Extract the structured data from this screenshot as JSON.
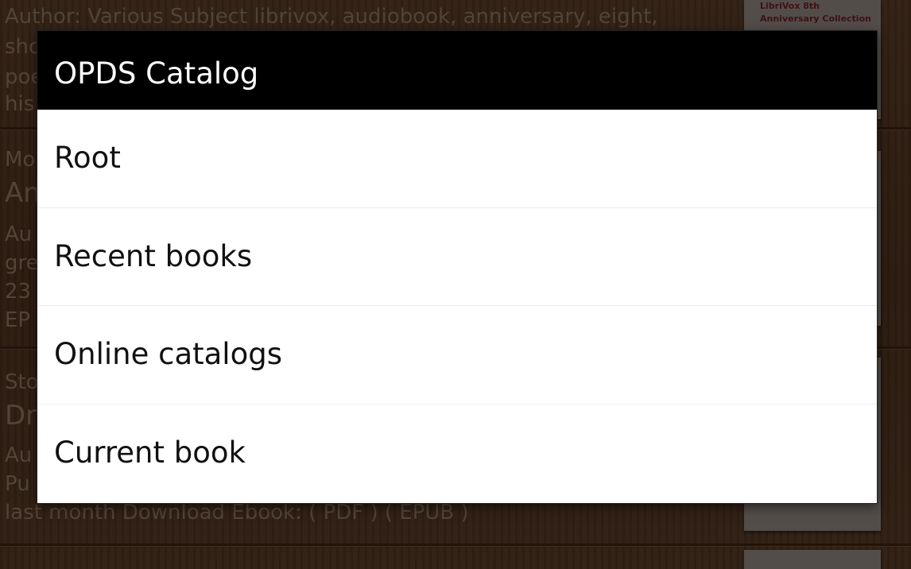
{
  "background": {
    "entry1": {
      "lines": [
        "Author: Various  Subject librivox, audiobook, anniversary, eight,",
        "sho",
        "poe",
        "his"
      ]
    },
    "entry2": {
      "lines": [
        "Mo",
        "An",
        "Au",
        "gre",
        "23",
        "EP"
      ]
    },
    "entry3": {
      "lines": [
        "Sto",
        "Dr",
        "Au",
        "Pu",
        "last month  Download Ebook: ( PDF ) ( EPUB )"
      ]
    },
    "cover1": {
      "text_line1": "LibriVox 8th",
      "text_line2": "Anniversary Collection"
    }
  },
  "dialog": {
    "title": "OPDS Catalog",
    "items": [
      {
        "label": "Root"
      },
      {
        "label": "Recent books"
      },
      {
        "label": "Online catalogs"
      },
      {
        "label": "Current book"
      }
    ]
  }
}
